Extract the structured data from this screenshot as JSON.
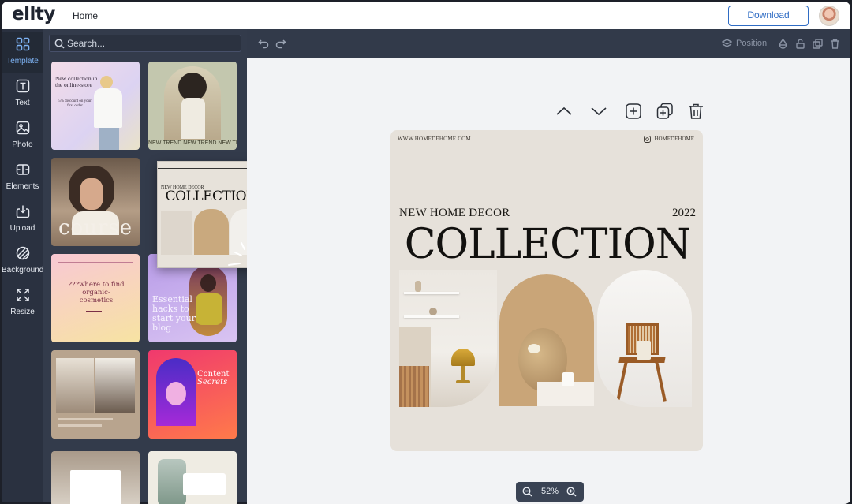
{
  "app": {
    "logo": "ellty",
    "nav_home": "Home",
    "download_label": "Download"
  },
  "sidebar": {
    "items": [
      {
        "label": "Template",
        "icon": "grid-icon",
        "active": true
      },
      {
        "label": "Text",
        "icon": "text-icon"
      },
      {
        "label": "Photo",
        "icon": "photo-icon"
      },
      {
        "label": "Elements",
        "icon": "elements-icon"
      },
      {
        "label": "Upload",
        "icon": "upload-icon"
      },
      {
        "label": "Background",
        "icon": "background-icon"
      },
      {
        "label": "Resize",
        "icon": "resize-icon"
      }
    ]
  },
  "search": {
    "placeholder": "Search..."
  },
  "templates": {
    "t1_title": "New collection in the online-store",
    "t1_offer": "5% discount on your first order",
    "t2_ticker": "NEW TREND NEW TREND NEW TRE",
    "t3_word": "course",
    "t4_sub": "NEW HOME DECOR",
    "t4_year": "2022",
    "t4_title": "COLLECTION",
    "t5_text": "???where to find organic-cosmetics",
    "t6_text": "Essential hacks to start your blog",
    "t8_title": "Content",
    "t8_sub": "Secrets"
  },
  "toolbar": {
    "position_label": "Position"
  },
  "design": {
    "url": "WWW.HOMEDEHOME.COM",
    "handle": "HOMEDEHOME",
    "subtitle": "NEW HOME DECOR",
    "year": "2022",
    "title": "COLLECTION"
  },
  "zoom": {
    "value": "52%"
  },
  "colors": {
    "accent": "#2f6cc4",
    "rail": "#2a3140",
    "panel": "#333b4b",
    "canvas": "#f2f3f5"
  }
}
